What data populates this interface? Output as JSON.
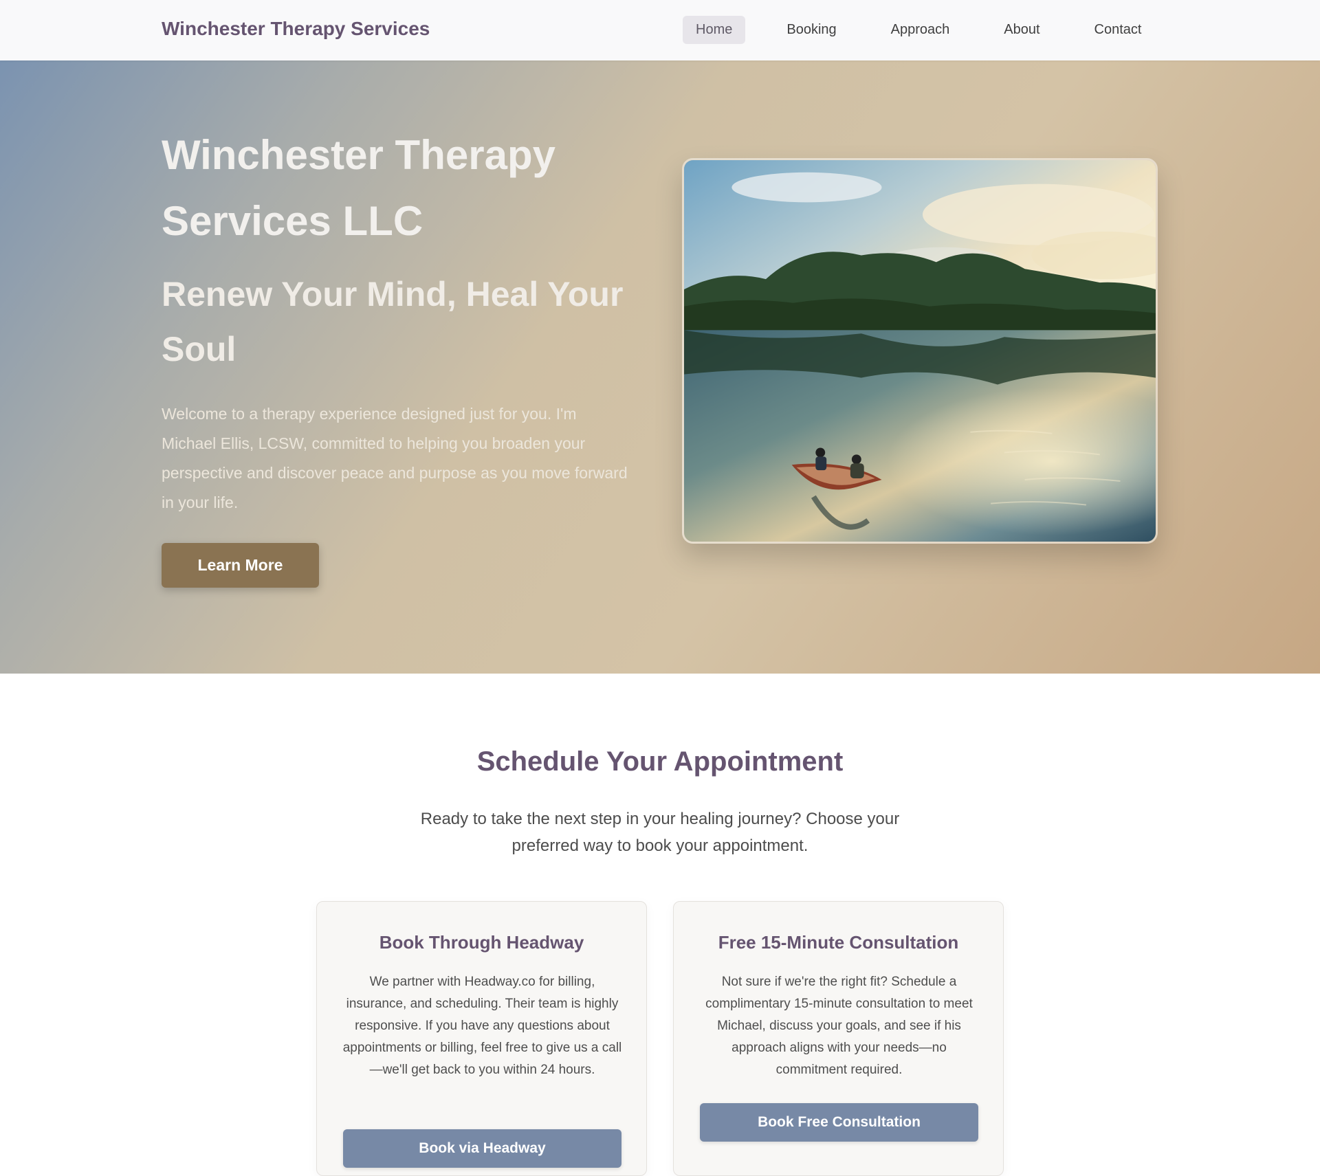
{
  "header": {
    "brand": "Winchester Therapy Services",
    "nav": [
      {
        "label": "Home",
        "active": true
      },
      {
        "label": "Booking",
        "active": false
      },
      {
        "label": "Approach",
        "active": false
      },
      {
        "label": "About",
        "active": false
      },
      {
        "label": "Contact",
        "active": false
      }
    ]
  },
  "hero": {
    "title": "Winchester Therapy Services LLC",
    "subtitle": "Renew Your Mind, Heal Your Soul",
    "text": "Welcome to a therapy experience designed just for you. I'm Michael Ellis, LCSW, committed to helping you broaden your perspective and discover peace and purpose as you move forward in your life.",
    "cta_label": "Learn More",
    "image": "lake-with-two-people-in-rowboat-at-sunset"
  },
  "appointment": {
    "title": "Schedule Your Appointment",
    "intro": "Ready to take the next step in your healing journey? Choose your preferred way to book your appointment.",
    "cards": [
      {
        "title": "Book Through Headway",
        "body": "We partner with Headway.co for billing, insurance, and scheduling. Their team is highly responsive. If you have any questions about appointments or billing, feel free to give us a call—we'll get back to you within 24 hours.",
        "button": "Book via Headway"
      },
      {
        "title": "Free 15-Minute Consultation",
        "body": "Not sure if we're the right fit? Schedule a complimentary 15-minute consultation to meet Michael, discuss your goals, and see if his approach aligns with your needs—no commitment required.",
        "button": "Book Free Consultation"
      }
    ]
  },
  "colors": {
    "brand": "#655470",
    "accent_button": "#8a7352",
    "booking_button": "#7789a6"
  }
}
